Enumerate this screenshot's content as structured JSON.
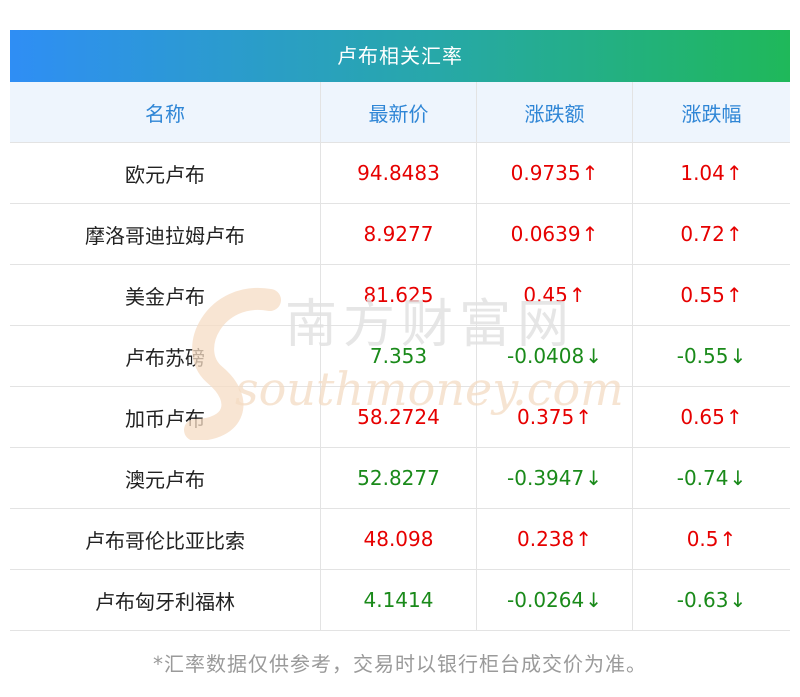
{
  "title": "卢布相关汇率",
  "columns": [
    "名称",
    "最新价",
    "涨跌额",
    "涨跌幅"
  ],
  "rows": [
    {
      "name": "欧元卢布",
      "price": "94.8483",
      "change": "0.9735",
      "pct": "1.04",
      "dir": "up",
      "arrow": "↑"
    },
    {
      "name": "摩洛哥迪拉姆卢布",
      "price": "8.9277",
      "change": "0.0639",
      "pct": "0.72",
      "dir": "up",
      "arrow": "↑"
    },
    {
      "name": "美金卢布",
      "price": "81.625",
      "change": "0.45",
      "pct": "0.55",
      "dir": "up",
      "arrow": "↑"
    },
    {
      "name": "卢布苏磅",
      "price": "7.353",
      "change": "-0.0408",
      "pct": "-0.55",
      "dir": "down",
      "arrow": "↓"
    },
    {
      "name": "加币卢布",
      "price": "58.2724",
      "change": "0.375",
      "pct": "0.65",
      "dir": "up",
      "arrow": "↑"
    },
    {
      "name": "澳元卢布",
      "price": "52.8277",
      "change": "-0.3947",
      "pct": "-0.74",
      "dir": "down",
      "arrow": "↓"
    },
    {
      "name": "卢布哥伦比亚比索",
      "price": "48.098",
      "change": "0.238",
      "pct": "0.5",
      "dir": "up",
      "arrow": "↑"
    },
    {
      "name": "卢布匈牙利福林",
      "price": "4.1414",
      "change": "-0.0264",
      "pct": "-0.63",
      "dir": "down",
      "arrow": "↓"
    }
  ],
  "watermark": {
    "cn": "南方财富网",
    "en": "southmoney.com"
  },
  "footnote": "*汇率数据仅供参考，交易时以银行柜台成交价为准。",
  "colors": {
    "up": "#e60000",
    "down": "#1a8a1a",
    "header_text": "#2f86d6",
    "title_from": "#2f8ef5",
    "title_to": "#1fb85a"
  }
}
